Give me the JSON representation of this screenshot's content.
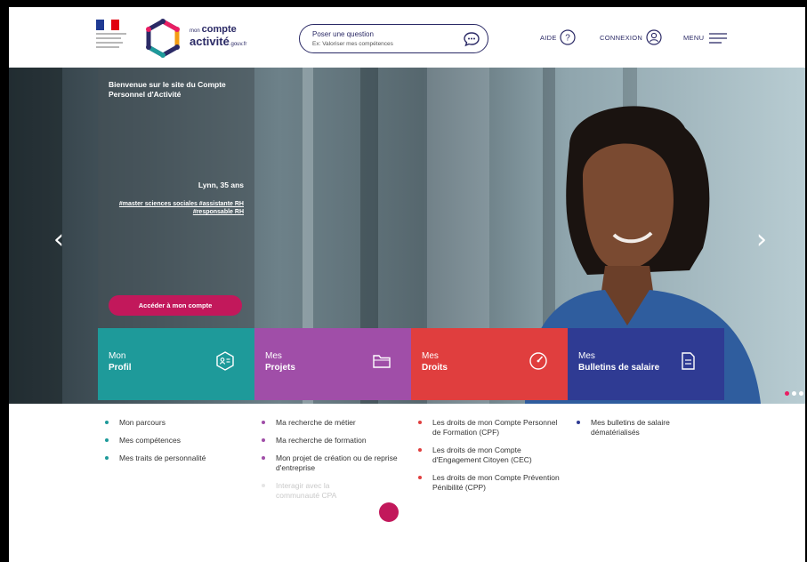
{
  "header": {
    "logo_line1_small": "mon",
    "logo_line1": "compte",
    "logo_line2": "activité",
    "logo_line2_small": ".gouv.fr",
    "search_label": "Poser une question",
    "search_placeholder": "Ex: Valoriser mes compétences",
    "aide": "AIDE",
    "connexion": "CONNEXION",
    "menu": "MENU"
  },
  "hero": {
    "welcome": "Bienvenue sur le site du Compte Personnel d'Activité",
    "person": "Lynn, 35 ans",
    "tags": "#master sciences sociales #assistante RH #responsable RH",
    "button": "Accéder à mon compte"
  },
  "tiles": [
    {
      "line1": "Mon",
      "line2": "Profil",
      "color": "#1e9a9a"
    },
    {
      "line1": "Mes",
      "line2": "Projets",
      "color": "#a04ea8"
    },
    {
      "line1": "Mes",
      "line2": "Droits",
      "color": "#e03e3e"
    },
    {
      "line1": "Mes",
      "line2": "Bulletins de salaire",
      "color": "#2f3b93"
    }
  ],
  "lists": {
    "profil": [
      "Mon parcours",
      "Mes compétences",
      "Mes traits de personnalité"
    ],
    "projets": [
      "Ma recherche de métier",
      "Ma recherche de formation",
      "Mon projet de création ou de reprise d'entreprise",
      "Interagir avec la communauté CPA"
    ],
    "droits": [
      "Les droits de mon Compte Personnel de Formation (CPF)",
      "Les droits de mon Compte d'Engagement Citoyen (CEC)",
      "Les droits de mon Compte Prévention Pénibilité (CPP)"
    ],
    "bulletins": [
      "Mes bulletins de salaire dématérialisés"
    ]
  },
  "colors": {
    "navy": "#2b2a66",
    "teal": "#1e9a9a",
    "purple": "#a04ea8",
    "red": "#e03e3e",
    "blue": "#2f3b93",
    "pink": "#c2185b"
  }
}
